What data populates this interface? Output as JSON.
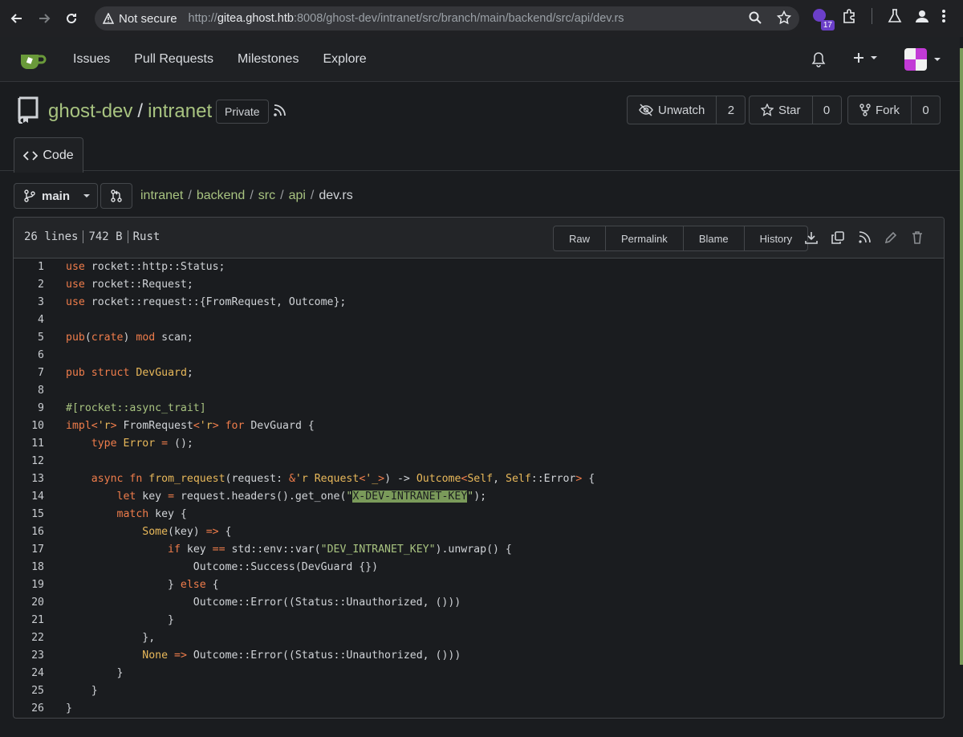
{
  "browser": {
    "security_label": "Not secure",
    "url_host": "gitea.ghost.htb",
    "url_rest": ":8008/ghost-dev/intranet/src/branch/main/backend/src/api/dev.rs",
    "url_scheme": "http://",
    "extension_badge": "17"
  },
  "nav": {
    "items": [
      "Issues",
      "Pull Requests",
      "Milestones",
      "Explore"
    ]
  },
  "repo": {
    "owner": "ghost-dev",
    "name": "intranet",
    "visibility": "Private",
    "unwatch_label": "Unwatch",
    "watch_count": "2",
    "star_label": "Star",
    "star_count": "0",
    "fork_label": "Fork",
    "fork_count": "0",
    "tab_code": "Code"
  },
  "branch": {
    "name": "main",
    "path": [
      "intranet",
      "backend",
      "src",
      "api"
    ],
    "file": "dev.rs"
  },
  "file": {
    "lines": "26 lines",
    "size": "742 B",
    "language": "Rust",
    "buttons": [
      "Raw",
      "Permalink",
      "Blame",
      "History"
    ]
  },
  "colors": {
    "accent": "#a8c380",
    "keyword": "#f07d4b",
    "type": "#e8b85a",
    "highlight": "#7a9a5a"
  }
}
